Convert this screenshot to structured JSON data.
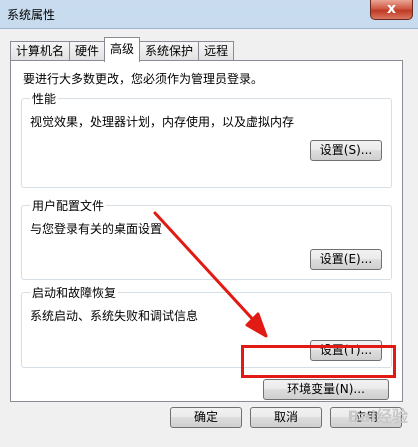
{
  "window": {
    "title": "系统属性",
    "close_glyph": "x"
  },
  "tabs": [
    {
      "label": "计算机名",
      "active": false
    },
    {
      "label": "硬件",
      "active": false
    },
    {
      "label": "高级",
      "active": true
    },
    {
      "label": "系统保护",
      "active": false
    },
    {
      "label": "远程",
      "active": false
    }
  ],
  "panel": {
    "admin_note": "要进行大多数更改，您必须作为管理员登录。",
    "performance": {
      "title": "性能",
      "desc": "视觉效果，处理器计划，内存使用，以及虚拟内存",
      "button": "设置(S)..."
    },
    "user_profiles": {
      "title": "用户配置文件",
      "desc": "与您登录有关的桌面设置",
      "button": "设置(E)..."
    },
    "startup_recovery": {
      "title": "启动和故障恢复",
      "desc": "系统启动、系统失败和调试信息",
      "button": "设置(T)..."
    },
    "env_button": "环境变量(N)..."
  },
  "footer": {
    "ok": "确定",
    "cancel": "取消",
    "apply": "应用"
  },
  "watermark": "Bai经验",
  "colors": {
    "highlight": "#e11b14",
    "arrow": "#e11b14"
  }
}
